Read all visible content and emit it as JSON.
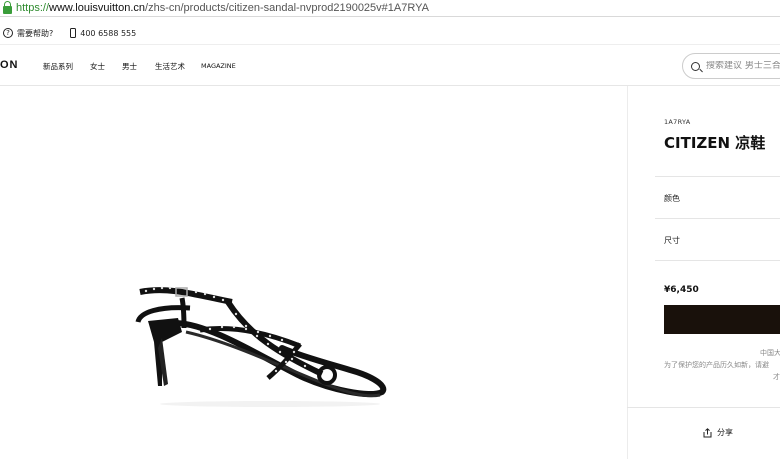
{
  "browser": {
    "url_scheme": "https://",
    "url_host": "www.louisvuitton.cn",
    "url_path": "/zhs-cn/products/citizen-sandal-nvprod2190025v#1A7RYA"
  },
  "utility": {
    "help_label": "需要帮助?",
    "phone": "400 6588 555"
  },
  "nav": {
    "logo": "ON",
    "items": [
      "新品系列",
      "女士",
      "男士",
      "生活艺术",
      "MAGAZINE"
    ],
    "search_placeholder": "搜索建议 男士三合"
  },
  "product": {
    "sku": "1A7RYA",
    "title": "CITIZEN 凉鞋",
    "color_label": "颜色",
    "size_label": "尺寸",
    "price": "¥6,450",
    "note_line1": "中国大",
    "note_line2": "为了保护您的产品历久如新，请避",
    "note_line3": "才",
    "share_label": "分享"
  },
  "colors": {
    "accent_dark": "#19110b",
    "url_green": "#2e8b2e"
  }
}
